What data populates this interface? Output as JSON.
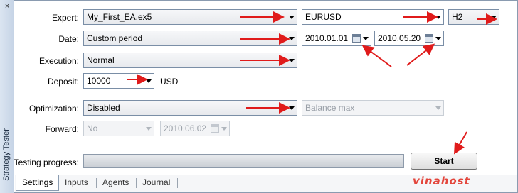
{
  "panel": {
    "vertical_title": "Strategy Tester",
    "close_glyph": "×"
  },
  "form": {
    "expert_label": "Expert:",
    "expert_value": "My_First_EA.ex5",
    "symbol_value": "EURUSD",
    "timeframe_value": "H2",
    "date_label": "Date:",
    "date_mode_value": "Custom period",
    "date_from": "2010.01.01",
    "date_to": "2010.05.20",
    "execution_label": "Execution:",
    "execution_value": "Normal",
    "deposit_label": "Deposit:",
    "deposit_value": "10000",
    "deposit_currency": "USD",
    "optimization_label": "Optimization:",
    "optimization_value": "Disabled",
    "optimization_criterion_value": "Balance max",
    "forward_label": "Forward:",
    "forward_value": "No",
    "forward_date": "2010.06.02",
    "progress_label": "Testing progress:",
    "start_button": "Start"
  },
  "tabs": [
    {
      "label": "Settings",
      "active": true
    },
    {
      "label": "Inputs",
      "active": false
    },
    {
      "label": "Agents",
      "active": false
    },
    {
      "label": "Journal",
      "active": false
    }
  ],
  "watermark": "vinahost",
  "colors": {
    "annotation_arrow": "#e01b1b",
    "frame_border": "#8a9bb0"
  }
}
